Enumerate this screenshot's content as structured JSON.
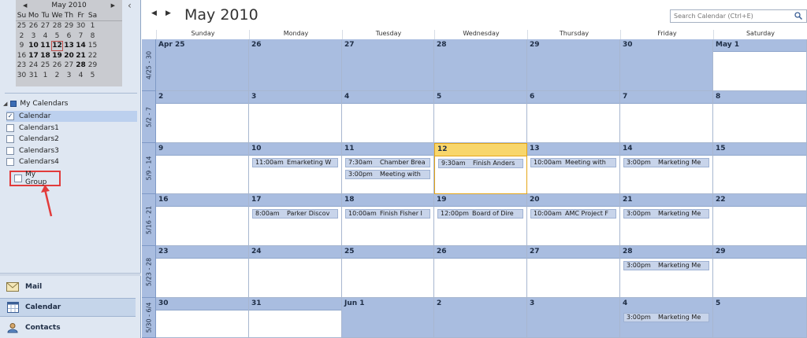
{
  "mini": {
    "title": "May 2010",
    "dow": [
      "Su",
      "Mo",
      "Tu",
      "We",
      "Th",
      "Fr",
      "Sa"
    ],
    "weeks": [
      [
        "25",
        "26",
        "27",
        "28",
        "29",
        "30",
        "1"
      ],
      [
        "2",
        "3",
        "4",
        "5",
        "6",
        "7",
        "8"
      ],
      [
        "9",
        "10",
        "11",
        "12",
        "13",
        "14",
        "15"
      ],
      [
        "16",
        "17",
        "18",
        "19",
        "20",
        "21",
        "22"
      ],
      [
        "23",
        "24",
        "25",
        "26",
        "27",
        "28",
        "29"
      ],
      [
        "30",
        "31",
        "1",
        "2",
        "3",
        "4",
        "5"
      ]
    ],
    "bold_days": [
      "10",
      "11",
      "12",
      "13",
      "14",
      "17",
      "18",
      "19",
      "20",
      "21",
      "28"
    ],
    "today": "12"
  },
  "nav": {
    "my_calendars_label": "My Calendars",
    "calendars": [
      {
        "label": "Calendar",
        "checked": true
      },
      {
        "label": "Calendars1",
        "checked": false
      },
      {
        "label": "Calendars2",
        "checked": false
      },
      {
        "label": "Calendars3",
        "checked": false
      },
      {
        "label": "Calendars4",
        "checked": false
      }
    ],
    "my_group_label": "My Group",
    "mail_label": "Mail",
    "calendar_label": "Calendar",
    "contacts_label": "Contacts"
  },
  "calendar": {
    "title": "May 2010",
    "search_placeholder": "Search Calendar (Ctrl+E)",
    "day_names": [
      "Sunday",
      "Monday",
      "Tuesday",
      "Wednesday",
      "Thursday",
      "Friday",
      "Saturday"
    ],
    "weeks": [
      {
        "label": "4/25 - 30",
        "days": [
          {
            "d": "Apr 25",
            "out": true
          },
          {
            "d": "26",
            "out": true
          },
          {
            "d": "27",
            "out": true
          },
          {
            "d": "28",
            "out": true
          },
          {
            "d": "29",
            "out": true
          },
          {
            "d": "30",
            "out": true
          },
          {
            "d": "May 1"
          }
        ]
      },
      {
        "label": "5/2 - 7",
        "days": [
          {
            "d": "2"
          },
          {
            "d": "3"
          },
          {
            "d": "4"
          },
          {
            "d": "5"
          },
          {
            "d": "6"
          },
          {
            "d": "7"
          },
          {
            "d": "8"
          }
        ]
      },
      {
        "label": "5/9 - 14",
        "days": [
          {
            "d": "9"
          },
          {
            "d": "10",
            "events": [
              {
                "time": "11:00am",
                "subject": "Emarketing W"
              }
            ]
          },
          {
            "d": "11",
            "events": [
              {
                "time": "7:30am",
                "subject": "Chamber Brea"
              },
              {
                "time": "3:00pm",
                "subject": "Meeting with"
              }
            ]
          },
          {
            "d": "12",
            "today": true,
            "events": [
              {
                "time": "9:30am",
                "subject": "Finish Anders"
              }
            ]
          },
          {
            "d": "13",
            "events": [
              {
                "time": "10:00am",
                "subject": "Meeting with"
              }
            ]
          },
          {
            "d": "14",
            "events": [
              {
                "time": "3:00pm",
                "subject": "Marketing Me"
              }
            ]
          },
          {
            "d": "15"
          }
        ]
      },
      {
        "label": "5/16 - 21",
        "days": [
          {
            "d": "16"
          },
          {
            "d": "17",
            "events": [
              {
                "time": "8:00am",
                "subject": "Parker Discov"
              }
            ]
          },
          {
            "d": "18",
            "events": [
              {
                "time": "10:00am",
                "subject": "Finish Fisher I"
              }
            ]
          },
          {
            "d": "19",
            "events": [
              {
                "time": "12:00pm",
                "subject": "Board of Dire"
              }
            ]
          },
          {
            "d": "20",
            "events": [
              {
                "time": "10:00am",
                "subject": "AMC Project F"
              }
            ]
          },
          {
            "d": "21",
            "events": [
              {
                "time": "3:00pm",
                "subject": "Marketing Me"
              }
            ]
          },
          {
            "d": "22"
          }
        ]
      },
      {
        "label": "5/23 - 28",
        "days": [
          {
            "d": "23"
          },
          {
            "d": "24"
          },
          {
            "d": "25"
          },
          {
            "d": "26"
          },
          {
            "d": "27"
          },
          {
            "d": "28",
            "events": [
              {
                "time": "3:00pm",
                "subject": "Marketing Me"
              }
            ]
          },
          {
            "d": "29"
          }
        ]
      },
      {
        "label": "5/30 - 6/4",
        "days": [
          {
            "d": "30"
          },
          {
            "d": "31"
          },
          {
            "d": "Jun 1",
            "out": true
          },
          {
            "d": "2",
            "out": true
          },
          {
            "d": "3",
            "out": true
          },
          {
            "d": "4",
            "out": true,
            "events": [
              {
                "time": "3:00pm",
                "subject": "Marketing Me"
              }
            ]
          },
          {
            "d": "5",
            "out": true
          }
        ]
      }
    ]
  },
  "colors": {
    "header_blue": "#a9bde0",
    "today_yellow": "#f8d66b",
    "highlight_red": "#e23b3b"
  }
}
